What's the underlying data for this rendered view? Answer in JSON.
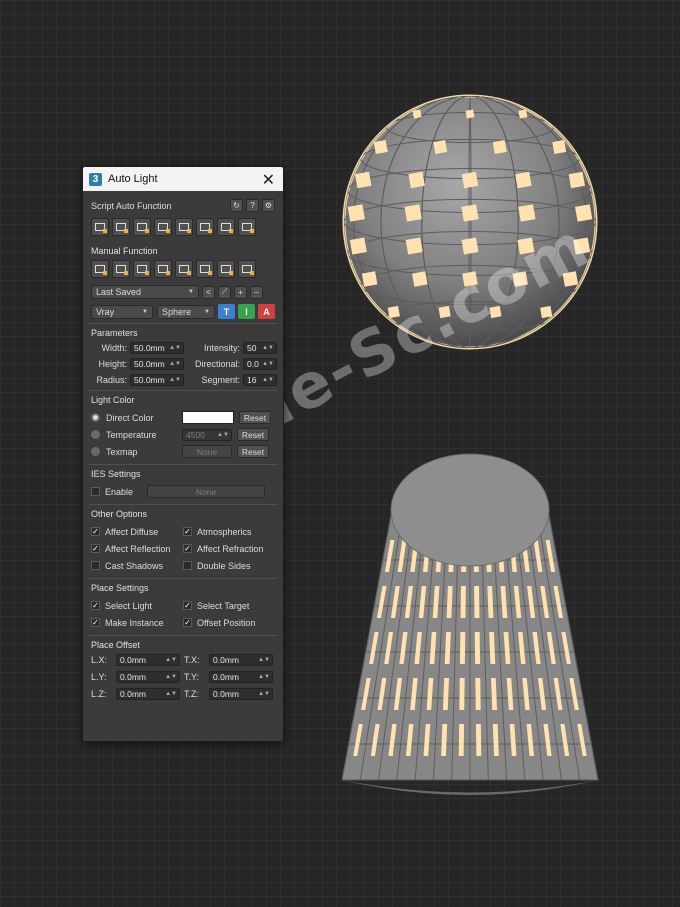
{
  "panel": {
    "title": "Auto Light",
    "logo": "3",
    "script_auto": {
      "title": "Script Auto Function",
      "header_buttons": [
        "↻",
        "?",
        "⚙"
      ],
      "icons": [
        "light-place-icon",
        "light-place-icon",
        "light-place-icon",
        "light-place-icon",
        "grid-icon",
        "plus-icon",
        "align-icon",
        "image-icon"
      ]
    },
    "manual": {
      "title": "Manual Function",
      "icons": [
        "light-place-icon",
        "light-place-icon",
        "light-place-icon",
        "light-place-icon",
        "target-icon",
        "panel-icon",
        "select-icon",
        "delete-icon"
      ],
      "preset": "Last Saved",
      "preset_buttons": [
        "<",
        "⟋",
        "+",
        "−"
      ],
      "renderer": "Vray",
      "shape": "Sphere",
      "color_buttons": [
        {
          "label": "T",
          "color": "#3b7fd1"
        },
        {
          "label": "I",
          "color": "#36a24a"
        },
        {
          "label": "A",
          "color": "#d34040"
        }
      ]
    },
    "parameters": {
      "title": "Parameters",
      "width_label": "Width:",
      "width_value": "50.0mm",
      "intensity_label": "Intensity:",
      "intensity_value": "50",
      "height_label": "Height:",
      "height_value": "50.0mm",
      "directional_label": "Directional:",
      "directional_value": "0.0",
      "radius_label": "Radius:",
      "radius_value": "50.0mm",
      "segment_label": "Segment:",
      "segment_value": "16"
    },
    "light_color": {
      "title": "Light Color",
      "direct_label": "Direct Color",
      "swatch": "#ffffff",
      "temperature_label": "Temperature",
      "temperature_value": "4500",
      "texmap_label": "Texmap",
      "texmap_value": "None",
      "reset": "Reset"
    },
    "ies": {
      "title": "IES Settings",
      "enable_label": "Enable",
      "none_label": "None"
    },
    "other": {
      "title": "Other Options",
      "affect_diffuse": "Affect Diffuse",
      "atmospherics": "Atmospherics",
      "affect_reflection": "Affect Reflection",
      "affect_refraction": "Affect Refraction",
      "cast_shadows": "Cast Shadows",
      "double_sides": "Double Sides"
    },
    "place": {
      "title": "Place Settings",
      "select_light": "Select Light",
      "select_target": "Select Target",
      "make_instance": "Make Instance",
      "offset_position": "Offset Position"
    },
    "offset": {
      "title": "Place Offset",
      "lx_label": "L.X:",
      "lx_value": "0.0mm",
      "tx_label": "T.X:",
      "tx_value": "0.0mm",
      "ly_label": "L.Y:",
      "ly_value": "0.0mm",
      "ty_label": "T.Y:",
      "ty_value": "0.0mm",
      "lz_label": "L.Z:",
      "lz_value": "0.0mm",
      "tz_label": "T.Z:",
      "tz_value": "0.0mm"
    }
  },
  "watermark": "MoHe-Sc.com",
  "colors": {
    "light_panel": "#ffe2b0",
    "mesh": "#8c8c8c"
  }
}
